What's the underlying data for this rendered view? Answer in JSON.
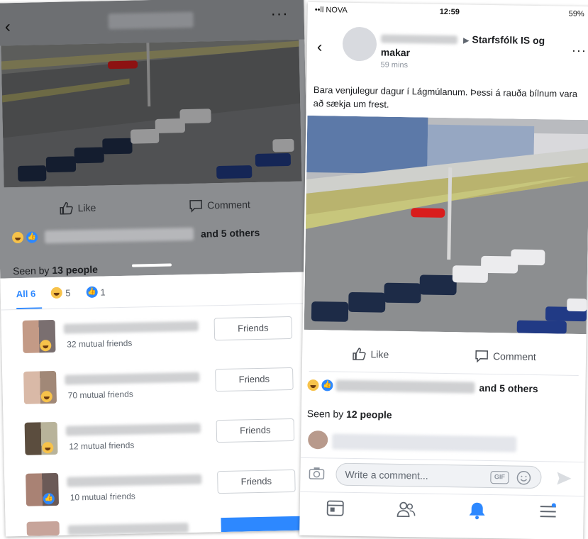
{
  "left_screen": {
    "nav": {
      "back_icon": "‹",
      "more_icon": "···"
    },
    "actions": {
      "like": "Like",
      "comment": "Comment"
    },
    "reactions": {
      "others_text": "and 5 others"
    },
    "seen": {
      "prefix": "Seen by",
      "count": "13 people"
    },
    "tabs": [
      {
        "label": "All 6",
        "icon": ""
      },
      {
        "label": "5",
        "icon": "haha-icon"
      },
      {
        "label": "1",
        "icon": "like-icon"
      }
    ],
    "people": [
      {
        "mutual": "32 mutual friends",
        "button": "Friends",
        "badge": "haha"
      },
      {
        "mutual": "70 mutual friends",
        "button": "Friends",
        "badge": "haha"
      },
      {
        "mutual": "12 mutual friends",
        "button": "Friends",
        "badge": "haha"
      },
      {
        "mutual": "10 mutual friends",
        "button": "Friends",
        "badge": "like"
      }
    ]
  },
  "right_screen": {
    "status_bar": {
      "carrier": "••ll NOVA",
      "time": "12:59",
      "battery": "59%"
    },
    "post": {
      "group_arrow": "▶",
      "group_name": "Starfsfólk IS og makar",
      "time": "59 mins",
      "caption": "Bara venjulegur dagur í Lágmúlanum. Þessi á rauða bílnum vara að sækja um frest."
    },
    "actions": {
      "like": "Like",
      "comment": "Comment"
    },
    "reactions": {
      "others_text": "and 5 others"
    },
    "seen": {
      "prefix": "Seen by",
      "count": "12 people"
    },
    "comment_bar": {
      "placeholder": "Write a comment...",
      "gif_label": "GIF"
    }
  },
  "colors": {
    "brand_blue": "#2d88ff",
    "dim_overlay": "#8b8d90",
    "car_red": "#d91c1c"
  }
}
